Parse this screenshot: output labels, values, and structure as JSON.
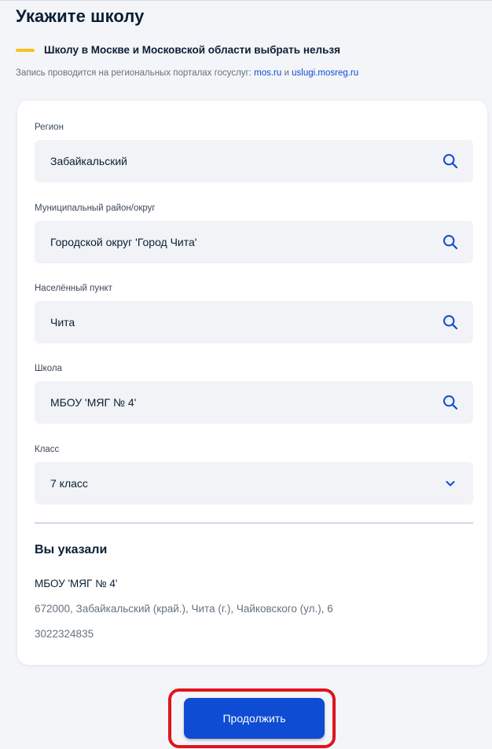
{
  "page": {
    "title": "Укажите школу"
  },
  "notice": {
    "text": "Школу в Москве и Московской области выбрать нельзя",
    "sub_prefix": "Запись проводится на региональных порталах госуслуг:",
    "link_1": "mos.ru",
    "conjunction": "и",
    "link_2": "uslugi.mosreg.ru"
  },
  "form": {
    "fields": [
      {
        "label": "Регион",
        "value": "Забайкальский",
        "icon": "search-icon"
      },
      {
        "label": "Муниципальный район/округ",
        "value": "Городской округ 'Город Чита'",
        "icon": "search-icon"
      },
      {
        "label": "Населённый пункт",
        "value": "Чита",
        "icon": "search-icon"
      },
      {
        "label": "Школа",
        "value": "МБОУ 'МЯГ № 4'",
        "icon": "search-icon"
      },
      {
        "label": "Класс",
        "value": "7 класс",
        "icon": "chevron-down-icon"
      }
    ]
  },
  "summary": {
    "title": "Вы указали",
    "school": "МБОУ 'МЯГ № 4'",
    "address": "672000, Забайкальский (край.), Чита (г.), Чайковского (ул.), 6",
    "phone": "3022324835"
  },
  "actions": {
    "continue_label": "Продолжить"
  },
  "colors": {
    "accent": "#0d4cd3",
    "notice_marker": "#f9c11c",
    "highlight_frame": "#e0141e",
    "field_background": "#f1f3f7"
  }
}
